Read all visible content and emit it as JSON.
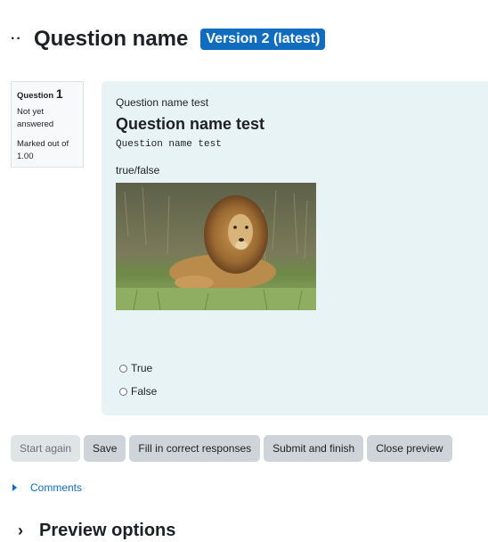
{
  "header": {
    "drag_icon": "··",
    "title": "Question name",
    "version_badge": "Version 2 (latest)",
    "badge_color": "#0f6cbf"
  },
  "question_info": {
    "label": "Question",
    "number": "1",
    "state": "Not yet answered",
    "grade": "Marked out of 1.00"
  },
  "question": {
    "name_small": "Question name test",
    "heading": "Question name test",
    "mono_text": "Question name test",
    "type_label": "true/false",
    "image": "lion-photo",
    "answers": [
      {
        "label": "True",
        "checked": false
      },
      {
        "label": "False",
        "checked": false
      }
    ]
  },
  "buttons": [
    {
      "label": "Start again",
      "disabled": true
    },
    {
      "label": "Save",
      "disabled": false
    },
    {
      "label": "Fill in correct responses",
      "disabled": false
    },
    {
      "label": "Submit and finish",
      "disabled": false
    },
    {
      "label": "Close preview",
      "disabled": false
    }
  ],
  "comments": {
    "label": "Comments",
    "icon": "triangle-right-icon"
  },
  "preview_options": {
    "label": "Preview options",
    "icon": "chevron-right-icon"
  }
}
